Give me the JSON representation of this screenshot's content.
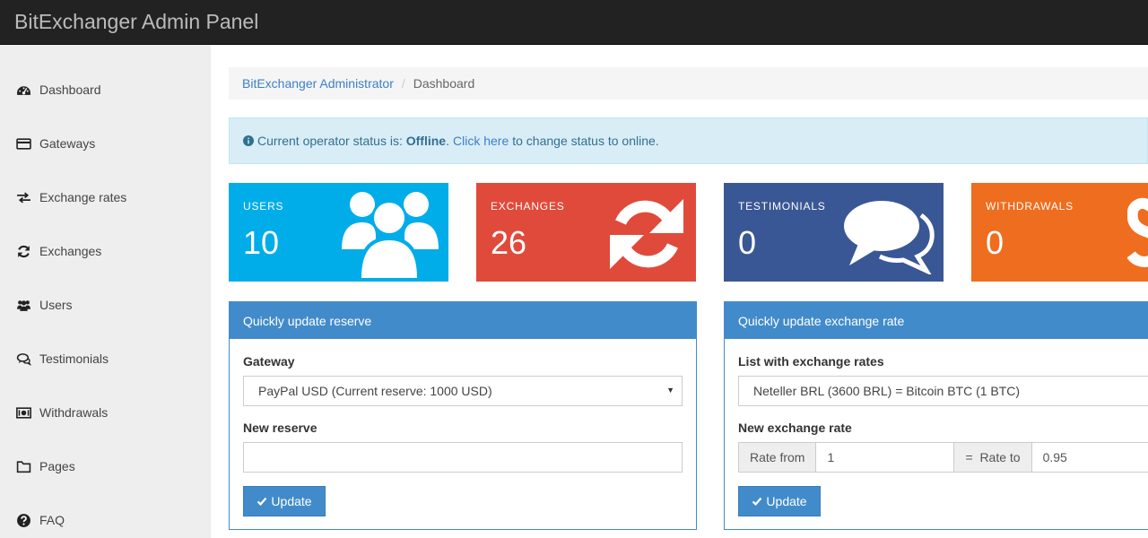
{
  "navbar": {
    "brand": "BitExchanger Admin Panel"
  },
  "sidebar": {
    "items": [
      {
        "label": "Dashboard",
        "icon": "dashboard-icon"
      },
      {
        "label": "Gateways",
        "icon": "credit-card-icon"
      },
      {
        "label": "Exchange rates",
        "icon": "exchange-icon"
      },
      {
        "label": "Exchanges",
        "icon": "refresh-icon"
      },
      {
        "label": "Users",
        "icon": "users-icon"
      },
      {
        "label": "Testimonials",
        "icon": "comments-icon"
      },
      {
        "label": "Withdrawals",
        "icon": "money-icon"
      },
      {
        "label": "Pages",
        "icon": "folder-icon"
      },
      {
        "label": "FAQ",
        "icon": "question-icon"
      }
    ]
  },
  "breadcrumb": {
    "root": "BitExchanger Administrator",
    "separator": "/",
    "current": "Dashboard"
  },
  "alert": {
    "prefix": "Current operator status is:",
    "status": "Offline",
    "period": ".",
    "link": "Click here",
    "suffix": "to change status to online."
  },
  "tiles": {
    "users": {
      "label": "USERS",
      "value": "10",
      "color": "#00ade9"
    },
    "exchanges": {
      "label": "EXCHANGES",
      "value": "26",
      "color": "#e04a3a"
    },
    "testimonials": {
      "label": "TESTIMONIALS",
      "value": "0",
      "color": "#3a5795"
    },
    "withdrawals": {
      "label": "WITHDRAWALS",
      "value": "0",
      "color": "#ef6d1f"
    }
  },
  "reserve_panel": {
    "title": "Quickly update reserve",
    "gateway_label": "Gateway",
    "gateway_value": "PayPal USD (Current reserve: 1000 USD)",
    "new_reserve_label": "New reserve",
    "new_reserve_value": "",
    "button": "Update"
  },
  "rate_panel": {
    "title": "Quickly update exchange rate",
    "list_label": "List with exchange rates",
    "list_value": "Neteller BRL (3600 BRL) = Bitcoin BTC (1 BTC)",
    "new_rate_label": "New exchange rate",
    "rate_from_label": "Rate from",
    "rate_from_value": "1",
    "equals": "=",
    "rate_to_label": "Rate to",
    "rate_to_value": "0.95",
    "button": "Update"
  },
  "colors": {
    "primary": "#428bca",
    "navbar": "#222222",
    "sidebar": "#eeeeee"
  }
}
